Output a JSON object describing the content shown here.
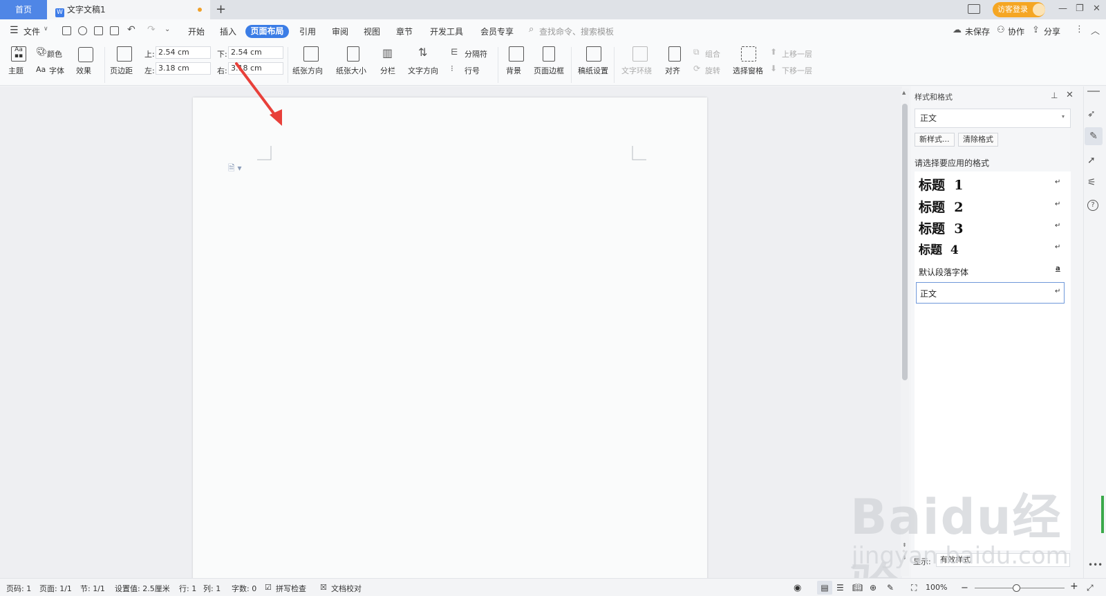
{
  "tabs": {
    "home": "首页",
    "doc": "文字文稿1",
    "doc_icon": "W",
    "login": "访客登录"
  },
  "menu": {
    "file": "文件",
    "items": [
      "开始",
      "插入",
      "页面布局",
      "引用",
      "审阅",
      "视图",
      "章节",
      "开发工具",
      "会员专享"
    ],
    "active": "页面布局",
    "search": "查找命令、搜索模板",
    "unsaved": "未保存",
    "collab": "协作",
    "share": "分享"
  },
  "ribbon": {
    "theme": "主题",
    "color": "颜色",
    "font": "字体",
    "effect": "效果",
    "margins": "页边距",
    "margin_top_label": "上:",
    "margin_top": "2.54 cm",
    "margin_bottom_label": "下:",
    "margin_bottom": "2.54 cm",
    "margin_left_label": "左:",
    "margin_left": "3.18 cm",
    "margin_right_label": "右:",
    "margin_right": "3.18 cm",
    "orientation": "纸张方向",
    "paper_size": "纸张大小",
    "columns": "分栏",
    "text_direction": "文字方向",
    "separator": "分隔符",
    "line_number": "行号",
    "background": "背景",
    "page_border": "页面边框",
    "grid_setting": "稿纸设置",
    "text_wrap": "文字环绕",
    "align": "对齐",
    "group": "组合",
    "rotate": "旋转",
    "selection_pane": "选择窗格",
    "bring_forward": "上移一层",
    "send_backward": "下移一层"
  },
  "panel": {
    "title": "样式和格式",
    "current_style": "正文",
    "new_style": "新样式...",
    "clear_format": "清除格式",
    "hint": "请选择要应用的格式",
    "styles": [
      {
        "name": "标题",
        "num": "1"
      },
      {
        "name": "标题",
        "num": "2"
      },
      {
        "name": "标题",
        "num": "3"
      },
      {
        "name": "标题",
        "num": "4"
      }
    ],
    "default_font": "默认段落字体",
    "body": "正文",
    "show_label": "显示:",
    "show_value": "有效样式"
  },
  "status": {
    "page_no": "页码: 1",
    "pages": "页面: 1/1",
    "section": "节: 1/1",
    "setting": "设置值: 2.5厘米",
    "row": "行: 1",
    "col": "列: 1",
    "word_count": "字数: 0",
    "spell": "拼写检查",
    "proof": "文档校对",
    "zoom": "100%"
  },
  "watermark": {
    "brand": "Baidu经验",
    "url": "jingyan.baidu.com"
  },
  "colors": {
    "accent": "#3b7de6",
    "home_tab": "#4f86e6",
    "login": "#f5a623",
    "arrow": "#e8403a"
  }
}
